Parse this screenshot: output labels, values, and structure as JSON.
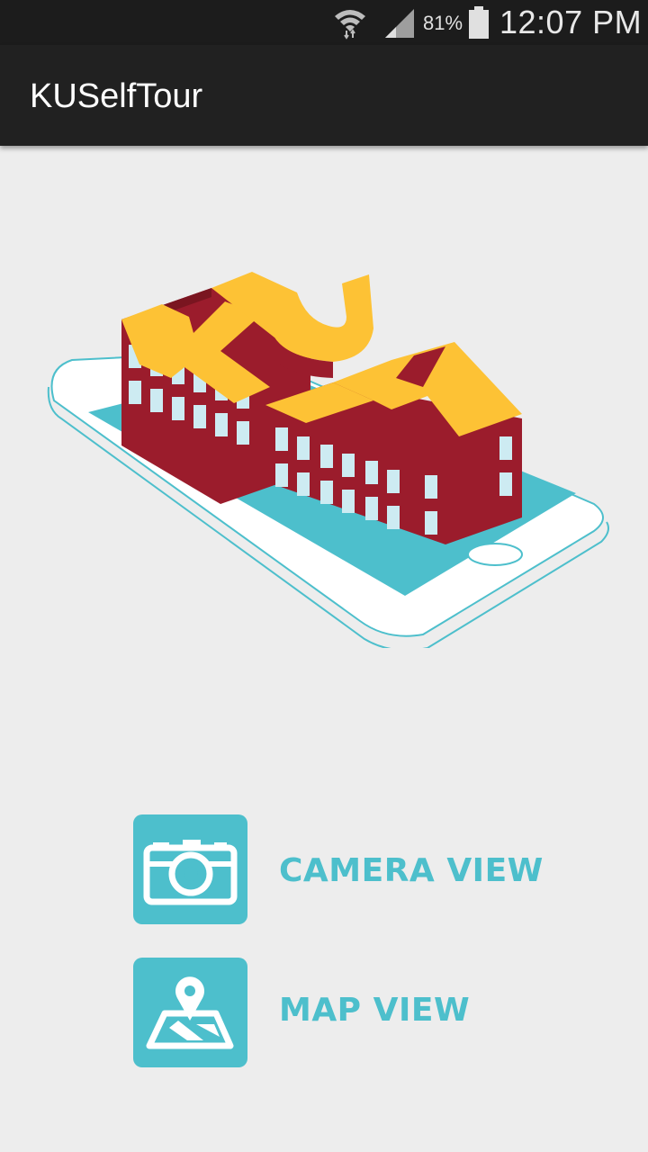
{
  "status_bar": {
    "battery_percent": "81%",
    "time": "12:07 PM"
  },
  "app_bar": {
    "title": "KUSelfTour"
  },
  "logo": {
    "text": "KU"
  },
  "menu": {
    "camera_label": "CAMERA VIEW",
    "camera_icon": "camera-icon",
    "map_label": "MAP VIEW",
    "map_icon": "map-pin-icon"
  },
  "colors": {
    "accent": "#4dbfcc",
    "building": "#9b1c2c",
    "logo_yellow": "#fdc235",
    "window": "#cdebf2",
    "background": "#ededed",
    "app_bar": "#212121"
  }
}
